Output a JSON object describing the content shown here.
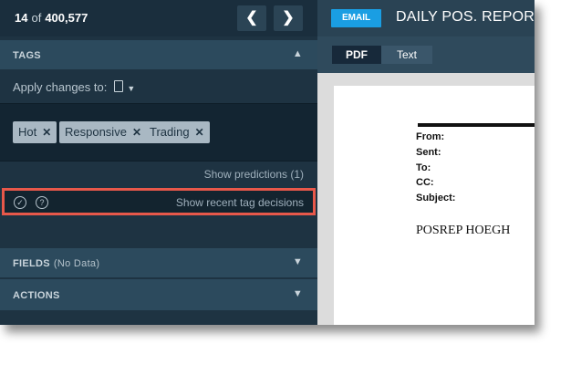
{
  "header": {
    "current": "14",
    "of_label": "of",
    "total": "400,577",
    "prev_glyph": "❮",
    "next_glyph": "❯"
  },
  "tags": {
    "section_title": "TAGS",
    "apply_label": "Apply changes to:",
    "chips": [
      "Hot",
      "Responsive",
      "Trading"
    ],
    "show_predictions": "Show predictions (1)",
    "show_recent": "Show recent tag decisions",
    "help_glyph": "?"
  },
  "fields": {
    "title": "FIELDS",
    "subtitle": "(No Data)"
  },
  "actions": {
    "title": "ACTIONS"
  },
  "document": {
    "badge": "EMAIL",
    "title": "DAILY POS. REPORT",
    "tabs": [
      "PDF",
      "Text"
    ],
    "header_labels": [
      "From:",
      "Sent:",
      "To:",
      "CC:",
      "Subject:"
    ],
    "body_start": "POSREP HOEGH"
  },
  "colors": {
    "highlight_border": "#e8584a",
    "email_badge": "#1a9ee3",
    "panel_dark": "#1e3342"
  }
}
